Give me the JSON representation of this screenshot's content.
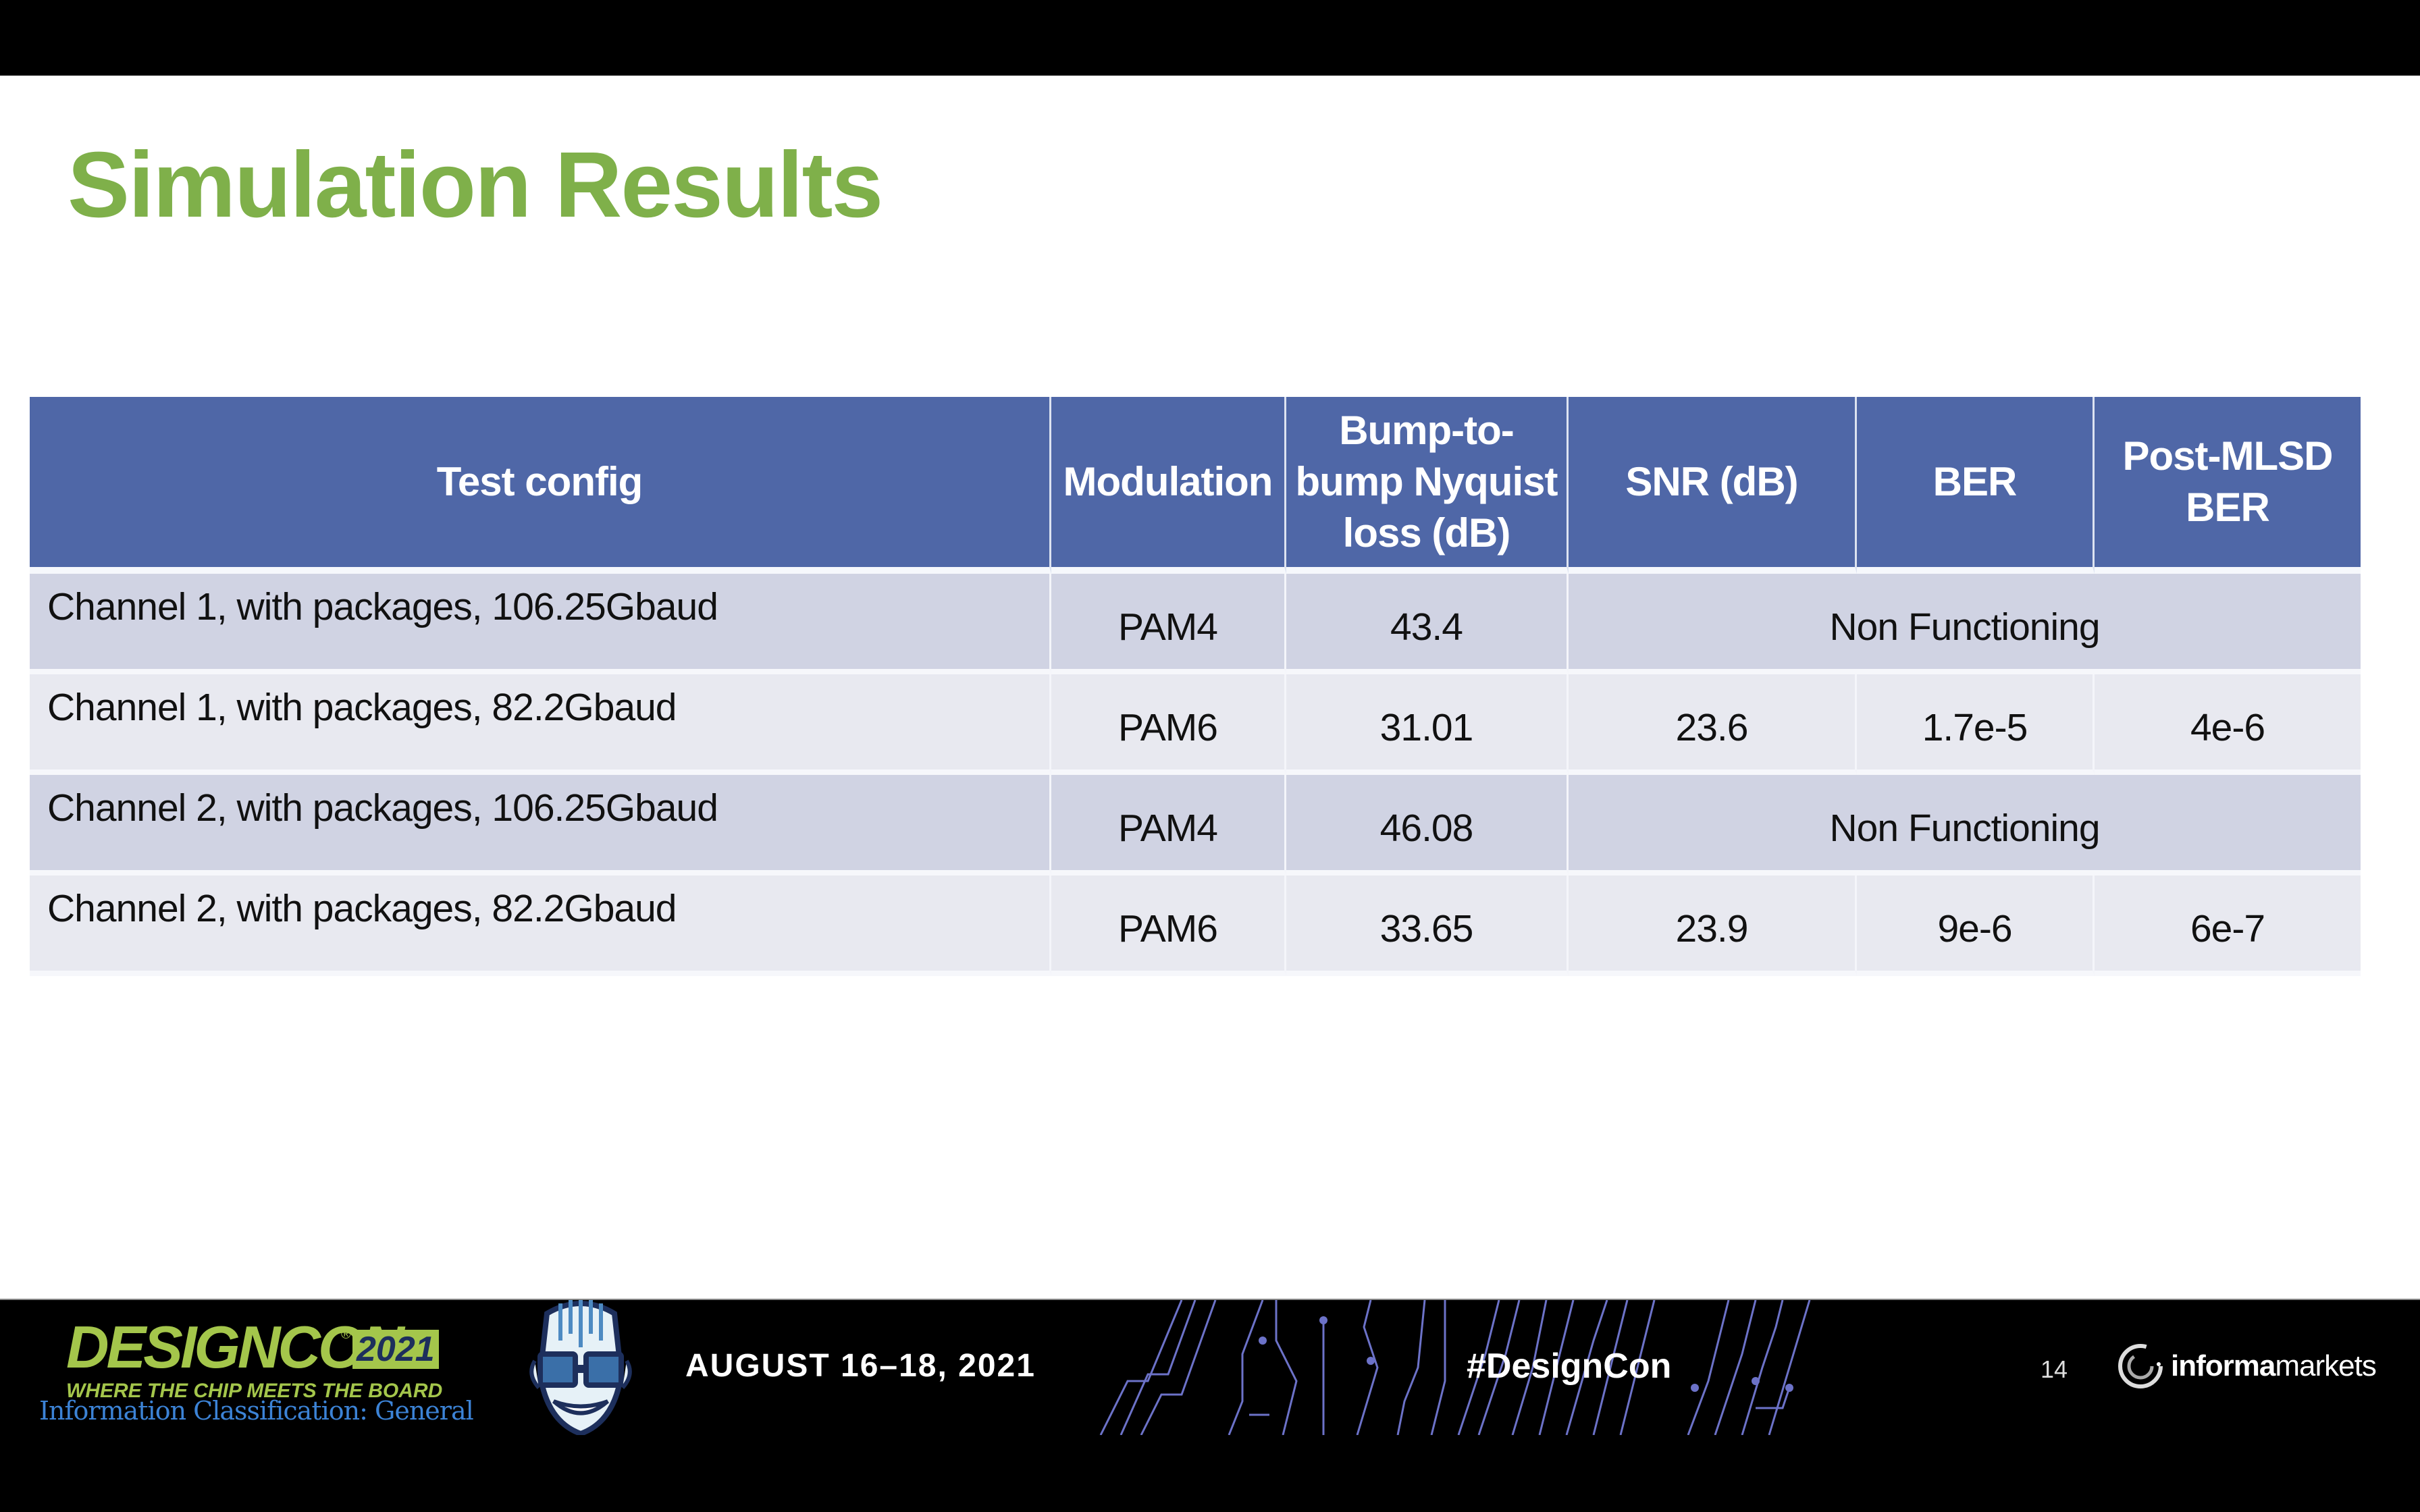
{
  "slide": {
    "title": "Simulation Results",
    "page_number": "14"
  },
  "table": {
    "headers": [
      "Test config",
      "Modulation",
      "Bump-to-bump Nyquist loss (dB)",
      "SNR (dB)",
      "BER",
      "Post-MLSD BER"
    ],
    "header_lines": {
      "col3": [
        "Bump-to-",
        "bump Nyquist",
        "loss (dB)"
      ],
      "col6": [
        "Post-MLSD",
        "BER"
      ]
    },
    "rows": [
      {
        "config": "Channel 1, with packages, 106.25Gbaud",
        "modulation": "PAM4",
        "loss": "43.4",
        "merged": "Non Functioning"
      },
      {
        "config": "Channel 1, with packages, 82.2Gbaud",
        "modulation": "PAM6",
        "loss": "31.01",
        "snr": "23.6",
        "ber": "1.7e-5",
        "post_mlsd_ber": "4e-6"
      },
      {
        "config": "Channel 2, with packages, 106.25Gbaud",
        "modulation": "PAM4",
        "loss": "46.08",
        "merged": "Non Functioning"
      },
      {
        "config": "Channel 2, with packages, 82.2Gbaud",
        "modulation": "PAM6",
        "loss": "33.65",
        "snr": "23.9",
        "ber": "9e-6",
        "post_mlsd_ber": "6e-7"
      }
    ]
  },
  "footer": {
    "logo_name": "DESIGNCON",
    "logo_reg": "®",
    "logo_year": "2021",
    "tagline": "WHERE THE CHIP MEETS THE BOARD",
    "classification": "Information Classification: General",
    "date": "AUGUST 16–18, 2021",
    "hashtag": "#DesignCon",
    "sponsor_bold": "informa",
    "sponsor_light": "markets"
  },
  "colors": {
    "title": "#7fb04a",
    "header_bg": "#4f67a7",
    "row_dark": "#d0d3e3",
    "row_light": "#e8e9f0",
    "logo_green": "#a4c64b",
    "classification_blue": "#3c83d6",
    "circuit": "#6c72c8"
  }
}
